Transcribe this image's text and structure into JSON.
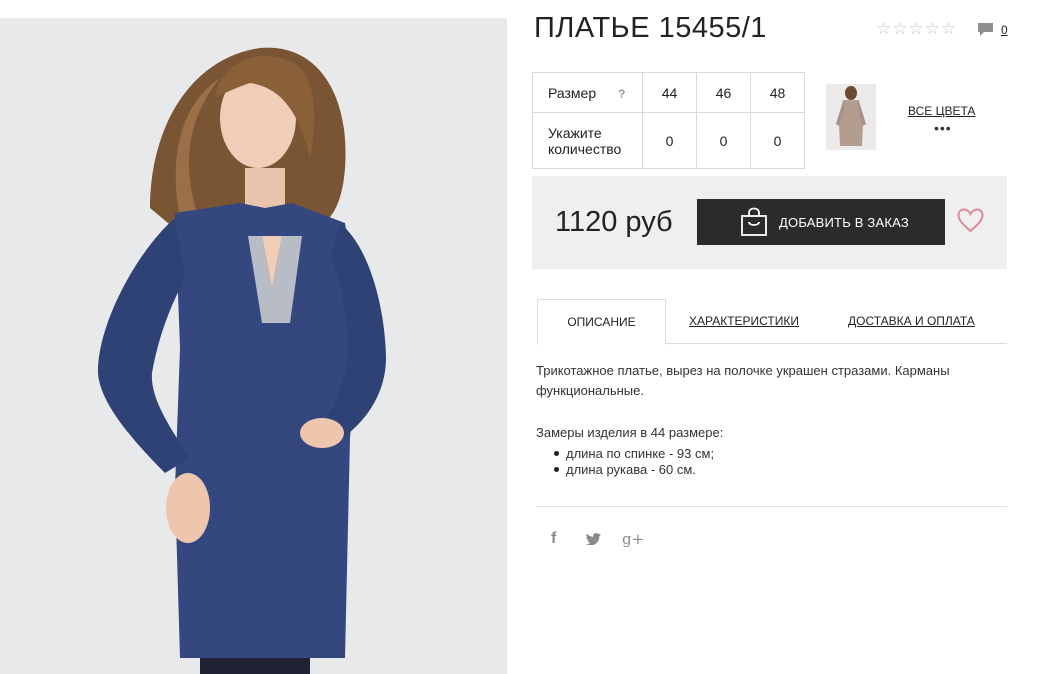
{
  "product": {
    "title": "ПЛАТЬЕ 15455/1",
    "comment_count": "0"
  },
  "sizes": {
    "size_label": "Размер",
    "help": "?",
    "quantity_label": "Укажите количество",
    "items": [
      {
        "size": "44",
        "qty": "0"
      },
      {
        "size": "46",
        "qty": "0"
      },
      {
        "size": "48",
        "qty": "0"
      }
    ]
  },
  "colors": {
    "all_colors_label": "ВСЕ ЦВЕТА",
    "more": "•••"
  },
  "purchase": {
    "price": "1120 руб",
    "add_to_order": "ДОБАВИТЬ В ЗАКАЗ"
  },
  "tabs": {
    "description": "ОПИСАНИЕ",
    "characteristics": "ХАРАКТЕРИСТИКИ",
    "delivery": "ДОСТАВКА И ОПЛАТА"
  },
  "description": {
    "text": "Трикотажное платье, вырез на полочке украшен стразами. Карманы функциональные.",
    "measures_title": "Замеры изделия в 44 размере:",
    "measures": [
      "длина по спинке - 93 см;",
      "длина рукава - 60 см."
    ]
  },
  "social": {
    "facebook": "f",
    "twitter": "🐦",
    "google_plus": "g+"
  },
  "colors_palette": {
    "dress": "#34487f",
    "button": "#2b2b2b",
    "heart": "#d98b97",
    "price_bg": "#efefef"
  }
}
